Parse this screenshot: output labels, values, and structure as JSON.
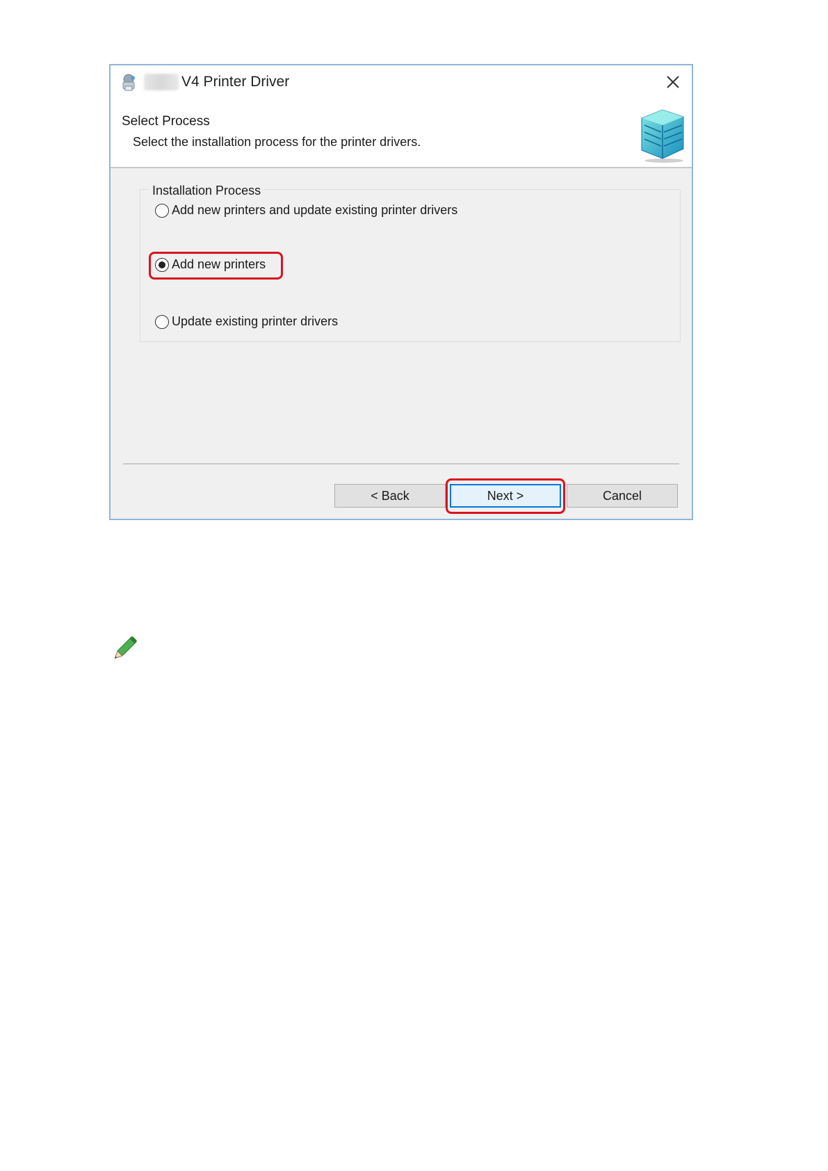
{
  "dialog": {
    "title": "V4 Printer Driver",
    "heading": "Select Process",
    "subheading": "Select the installation process for the printer drivers.",
    "close_icon": "close-icon",
    "app_icon": "installer-icon",
    "header_graphic": "printer-stack-graphic"
  },
  "installation_process": {
    "label": "Installation Process",
    "options": [
      {
        "label": "Add new printers and update existing printer drivers",
        "selected": false
      },
      {
        "label": "Add new printers",
        "selected": true
      },
      {
        "label": "Update existing printer drivers",
        "selected": false
      }
    ]
  },
  "buttons": {
    "back": "< Back",
    "next": "Next >",
    "cancel": "Cancel"
  },
  "colors": {
    "highlight": "#d9141e",
    "accent": "#0078d7",
    "window_border": "#8fb7d9"
  },
  "note_icon": "pencil-icon"
}
